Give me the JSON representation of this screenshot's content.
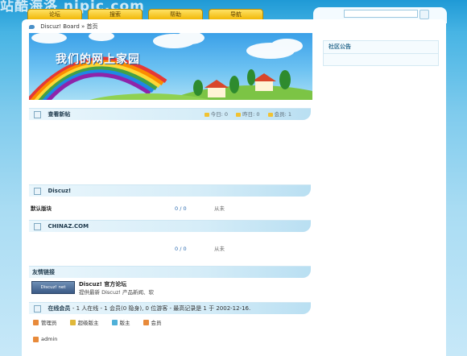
{
  "watermark_top": "站酷海洛 nipic.com",
  "nav": {
    "tabs": [
      {
        "label": "论坛"
      },
      {
        "label": "搜索"
      },
      {
        "label": "帮助"
      },
      {
        "label": "导航"
      }
    ]
  },
  "search": {
    "placeholder": ""
  },
  "breadcrumb": {
    "board": "Discuz! Board",
    "separator": "»",
    "current": "首页"
  },
  "banner": {
    "title": "我们的网上家园"
  },
  "sidebar": {
    "announce_title": "社区公告"
  },
  "sections": {
    "new_posts": {
      "title": "查看新帖",
      "stats": {
        "today_label": "今日:",
        "today": "0",
        "yesterday_label": "昨日:",
        "yesterday": "0",
        "members_label": "会员:",
        "members": "1"
      }
    },
    "discuz": {
      "title": "Discuz!"
    },
    "default_forum": {
      "name": "默认版块",
      "count": "0 / 0",
      "last": "从未"
    },
    "chinaz": {
      "title": "CHINAZ.COM",
      "count": "0 / 0",
      "last": "从未"
    },
    "links": {
      "title": "友情链接",
      "logo_text": "Discuz! net",
      "item_title": "Discuz! 官方论坛",
      "item_desc": "提供最新 Discuz! 产品新闻、软"
    },
    "online": {
      "title": "在线会员",
      "summary": "- 1 人在线 - 1 会员(0 隐身), 0 位游客 - 最高记录是 1 于 2002-12-16.",
      "legend": [
        {
          "label": "管理员",
          "color": "#e88a3a"
        },
        {
          "label": "超级版主",
          "color": "#e0b83a"
        },
        {
          "label": "版主",
          "color": "#4fb0d8"
        },
        {
          "label": "会员",
          "color": "#e88a3a"
        }
      ],
      "user": "admin"
    }
  },
  "colors": {
    "nav_tab": "#f0b500",
    "header_gradient": "#b9dff2",
    "sky": "#47b4e4"
  }
}
